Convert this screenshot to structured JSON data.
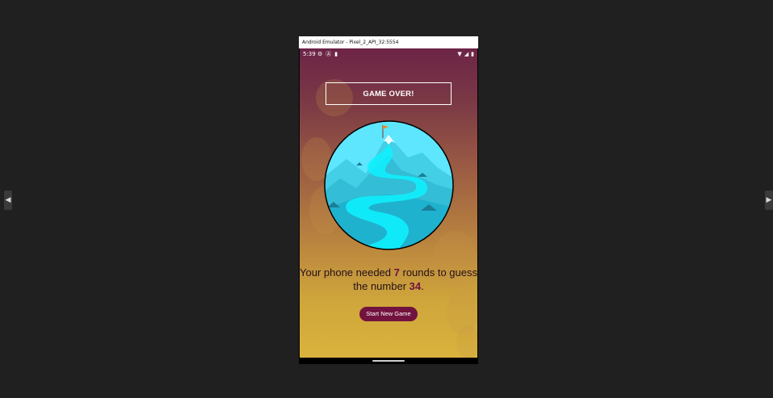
{
  "desktop": {
    "left_arrow_icon": "◀",
    "right_arrow_icon": "▶"
  },
  "emulator": {
    "window_title": "Android Emulator - Pixel_2_API_32:5554"
  },
  "status_bar": {
    "time": "5:39",
    "left_icons": [
      "settings-icon",
      "font-icon",
      "sd-card-icon"
    ],
    "right_icons": [
      "wifi-icon",
      "signal-icon",
      "battery-icon"
    ]
  },
  "screen": {
    "title": "GAME OVER!",
    "message": {
      "part1": "Your phone needed ",
      "rounds": "7",
      "part2": " rounds to guess the number ",
      "number": "34",
      "part3": "."
    },
    "start_button_label": "Start New Game"
  },
  "colors": {
    "gradient_top": "#6d2447",
    "gradient_bottom": "#d9b33d",
    "accent": "#72133f",
    "sky": "#5ee6ff",
    "circle_border": "#000000"
  }
}
